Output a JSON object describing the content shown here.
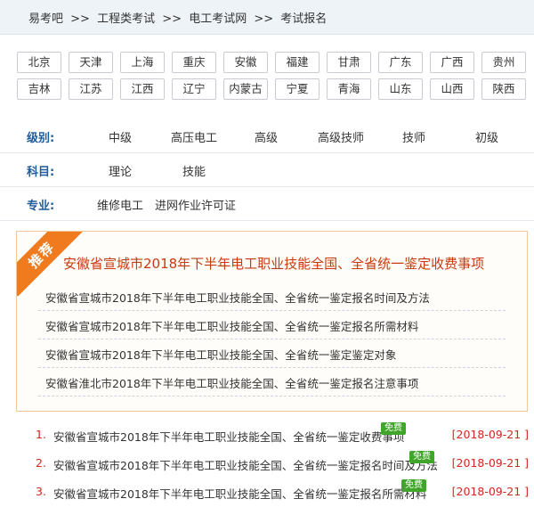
{
  "breadcrumb": [
    "易考吧",
    ">>",
    "工程类考试",
    ">>",
    "电工考试网",
    ">>",
    "考试报名"
  ],
  "regions_row1": [
    "北京",
    "天津",
    "上海",
    "重庆",
    "安徽",
    "福建",
    "甘肃",
    "广东",
    "广西",
    "贵州"
  ],
  "regions_row2": [
    "吉林",
    "江苏",
    "江西",
    "辽宁",
    "内蒙古",
    "宁夏",
    "青海",
    "山东",
    "山西",
    "陕西"
  ],
  "filters": {
    "level": {
      "label": "级别:",
      "options": [
        "中级",
        "高压电工",
        "高级",
        "高级技师",
        "技师",
        "初级"
      ]
    },
    "subject": {
      "label": "科目:",
      "options": [
        "理论",
        "技能"
      ]
    },
    "major": {
      "label": "专业:",
      "options": [
        "维修电工",
        "进网作业许可证"
      ]
    }
  },
  "recommend": {
    "ribbon": "推荐",
    "title": "安徽省宣城市2018年下半年电工职业技能全国、全省统一鉴定收费事项",
    "items": [
      "安徽省宣城市2018年下半年电工职业技能全国、全省统一鉴定报名时间及方法",
      "安徽省宣城市2018年下半年电工职业技能全国、全省统一鉴定报名所需材料",
      "安徽省宣城市2018年下半年电工职业技能全国、全省统一鉴定鉴定对象",
      "安徽省淮北市2018年下半年电工职业技能全国、全省统一鉴定报名注意事项"
    ]
  },
  "news": [
    {
      "num": "1.",
      "text": "安徽省宣城市2018年下半年电工职业技能全国、全省统一鉴定收费事项",
      "badge": "免费",
      "date": "[2018-09-21 ]"
    },
    {
      "num": "2.",
      "text": "安徽省宣城市2018年下半年电工职业技能全国、全省统一鉴定报名时间及方法",
      "badge": "免费",
      "date": "[2018-09-21 ]"
    },
    {
      "num": "3.",
      "text": "安徽省宣城市2018年下半年电工职业技能全国、全省统一鉴定报名所需材料",
      "badge": "免费",
      "date": "[2018-09-21 ]"
    }
  ]
}
